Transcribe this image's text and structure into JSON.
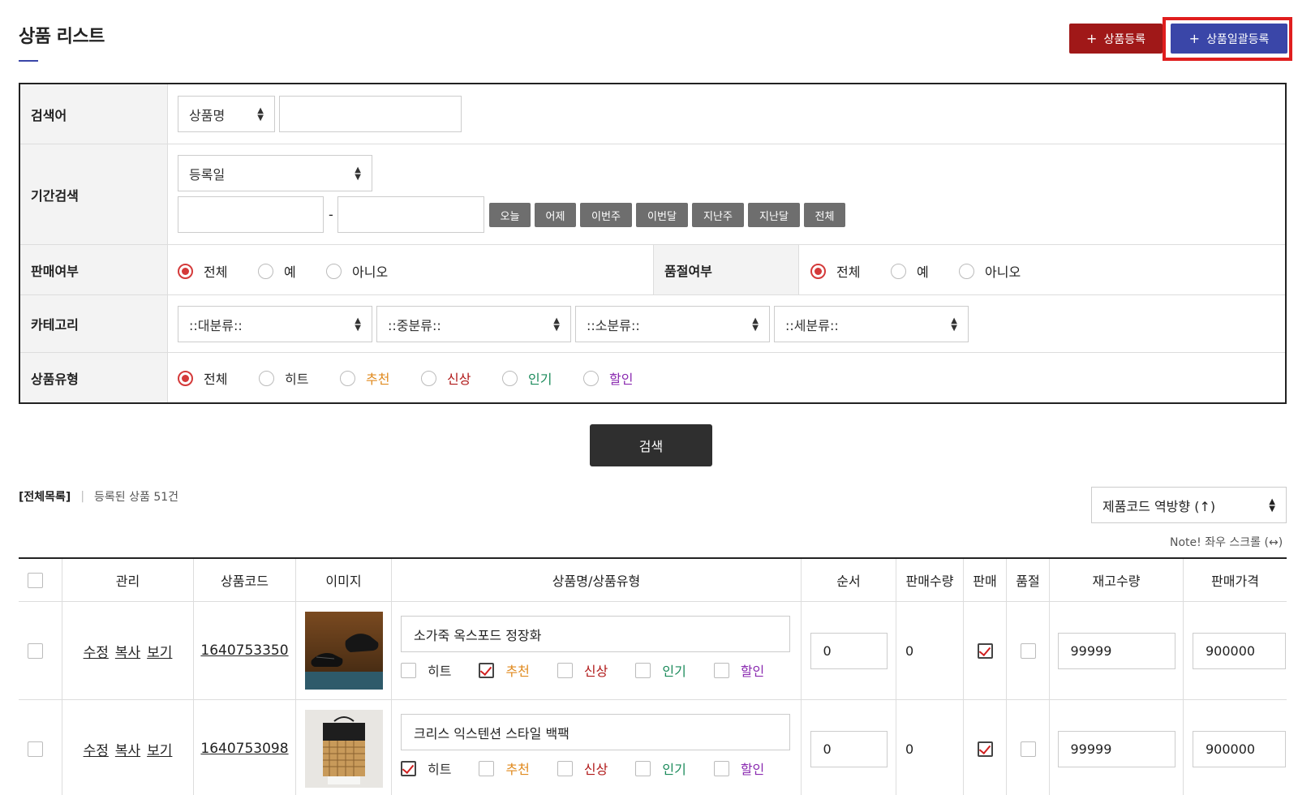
{
  "header": {
    "title": "상품 리스트",
    "register_button": "상품등록",
    "bulk_register_button": "상품일괄등록",
    "plus": "+"
  },
  "search": {
    "keyword": {
      "label": "검색어",
      "field_select": "상품명",
      "value": ""
    },
    "period": {
      "label": "기간검색",
      "date_type": "등록일",
      "start": "",
      "dash": "-",
      "end": "",
      "quick": [
        "오늘",
        "어제",
        "이번주",
        "이번달",
        "지난주",
        "지난달",
        "전체"
      ]
    },
    "sale": {
      "label": "판매여부",
      "options": [
        "전체",
        "예",
        "아니오"
      ],
      "selected": "전체"
    },
    "soldout": {
      "label": "품절여부",
      "options": [
        "전체",
        "예",
        "아니오"
      ],
      "selected": "전체"
    },
    "category": {
      "label": "카테고리",
      "selects": [
        "::대분류::",
        "::중분류::",
        "::소분류::",
        "::세분류::"
      ]
    },
    "product_type": {
      "label": "상품유형",
      "options": [
        "전체",
        "히트",
        "추천",
        "신상",
        "인기",
        "할인"
      ],
      "selected": "전체"
    },
    "submit": "검색"
  },
  "colors": {
    "accent": "#3a46a8",
    "register": "#a01818",
    "highlight": "#e01e1e",
    "type_hit": "#333333",
    "type_recommend": "#e08a1e",
    "type_new": "#b01818",
    "type_popular": "#1a8a5a",
    "type_sale": "#8a2ab0"
  },
  "list": {
    "scope": "[전체목록]",
    "count_text": "등록된 상품 51건",
    "sort": "제품코드 역방향 (↑)",
    "note": "Note! 좌우 스크롤 (↔)",
    "columns": [
      "관리",
      "상품코드",
      "이미지",
      "상품명/상품유형",
      "순서",
      "판매수량",
      "판매",
      "품절",
      "재고수량",
      "판매가격"
    ],
    "actions": [
      "수정",
      "복사",
      "보기"
    ],
    "type_labels": [
      "히트",
      "추천",
      "신상",
      "인기",
      "할인"
    ],
    "rows": [
      {
        "code": "1640753350",
        "image": "black-oxford-shoes",
        "name": "소가죽 옥스포드 정장화",
        "types_checked": [
          false,
          true,
          false,
          false,
          false
        ],
        "order": "0",
        "sold_qty": "0",
        "on_sale": true,
        "sold_out": false,
        "stock": "99999",
        "price": "900000"
      },
      {
        "code": "1640753098",
        "image": "woven-backpack",
        "name": "크리스 익스텐션 스타일 백팩",
        "types_checked": [
          true,
          false,
          false,
          false,
          false
        ],
        "order": "0",
        "sold_qty": "0",
        "on_sale": true,
        "sold_out": false,
        "stock": "99999",
        "price": "900000"
      }
    ]
  }
}
